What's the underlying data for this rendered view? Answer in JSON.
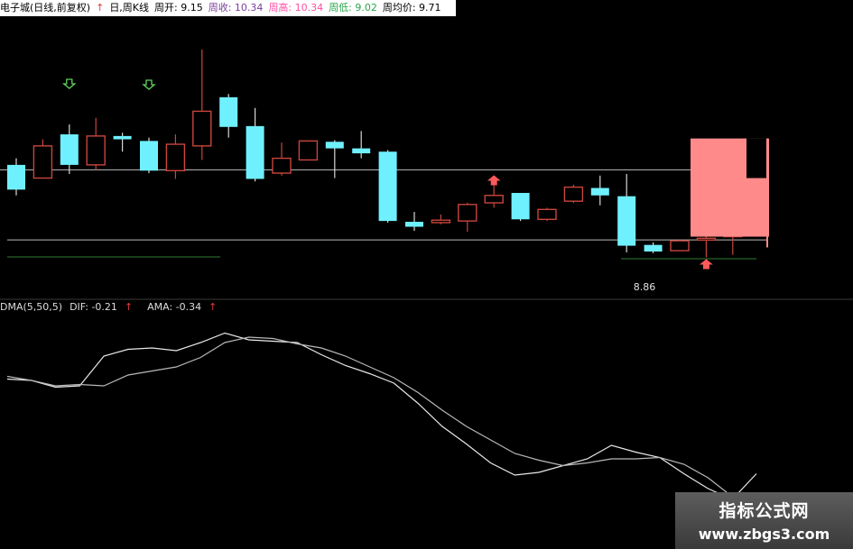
{
  "header": {
    "title": "电子城(日线,前复权)",
    "period_arrow": "↑",
    "period_label": "日,周K线",
    "open_label": "周开: 9.15",
    "close_label": "周收: 10.34",
    "high_label": "周高: 10.34",
    "low_label": "周低: 9.02",
    "avg_label": "周均价: 9.71"
  },
  "indicator": {
    "name": "DMA(5,50,5)",
    "dif_label": "DIF: -0.21",
    "ama_label": "AMA: -0.34",
    "arrow": "↑"
  },
  "price_label": "8.86",
  "watermark": {
    "title": "指标公式网",
    "url": "www.zbgs3.com"
  },
  "colors": {
    "up": "#c8453c",
    "down": "#6ff0ff",
    "weekly": "#ff8a8a",
    "line": "#d0d0d0",
    "low_line": "#2e7d32",
    "arrow_down": "#5fd35f",
    "arrow_up": "#ff5a5a"
  },
  "chart_data": [
    {
      "type": "candlestick",
      "title": "电子城(日线,前复权)",
      "price_scale": {
        "top": 11.8,
        "bottom": 8.5
      },
      "candles": [
        {
          "o": 10.02,
          "c": 9.72,
          "h": 10.1,
          "l": 9.65
        },
        {
          "o": 9.86,
          "c": 10.25,
          "h": 10.33,
          "l": 9.86
        },
        {
          "o": 10.39,
          "c": 10.02,
          "h": 10.51,
          "l": 9.91
        },
        {
          "o": 10.02,
          "c": 10.37,
          "h": 10.59,
          "l": 9.96
        },
        {
          "o": 10.37,
          "c": 10.33,
          "h": 10.41,
          "l": 10.18
        },
        {
          "o": 10.31,
          "c": 9.95,
          "h": 10.35,
          "l": 9.92
        },
        {
          "o": 9.95,
          "c": 10.27,
          "h": 10.39,
          "l": 9.85
        },
        {
          "o": 10.25,
          "c": 10.67,
          "h": 11.42,
          "l": 10.08
        },
        {
          "o": 10.84,
          "c": 10.48,
          "h": 10.88,
          "l": 10.35
        },
        {
          "o": 10.49,
          "c": 9.85,
          "h": 10.71,
          "l": 9.82
        },
        {
          "o": 9.92,
          "c": 10.1,
          "h": 10.29,
          "l": 9.89
        },
        {
          "o": 10.08,
          "c": 10.31,
          "h": 10.31,
          "l": 10.08
        },
        {
          "o": 10.3,
          "c": 10.22,
          "h": 10.32,
          "l": 9.86
        },
        {
          "o": 10.22,
          "c": 10.16,
          "h": 10.43,
          "l": 10.1
        },
        {
          "o": 10.18,
          "c": 9.34,
          "h": 10.2,
          "l": 9.32
        },
        {
          "o": 9.33,
          "c": 9.27,
          "h": 9.45,
          "l": 9.22
        },
        {
          "o": 9.32,
          "c": 9.35,
          "h": 9.42,
          "l": 9.3
        },
        {
          "o": 9.34,
          "c": 9.54,
          "h": 9.56,
          "l": 9.21
        },
        {
          "o": 9.56,
          "c": 9.65,
          "h": 9.78,
          "l": 9.5
        },
        {
          "o": 9.68,
          "c": 9.36,
          "h": 9.68,
          "l": 9.34
        },
        {
          "o": 9.36,
          "c": 9.48,
          "h": 9.5,
          "l": 9.34
        },
        {
          "o": 9.58,
          "c": 9.75,
          "h": 9.78,
          "l": 9.56
        },
        {
          "o": 9.74,
          "c": 9.65,
          "h": 9.89,
          "l": 9.53
        },
        {
          "o": 9.64,
          "c": 9.04,
          "h": 9.91,
          "l": 8.96
        },
        {
          "o": 9.05,
          "c": 8.97,
          "h": 9.08,
          "l": 8.95
        },
        {
          "o": 8.98,
          "c": 9.1,
          "h": 9.11,
          "l": 8.98
        },
        {
          "o": 9.11,
          "c": 9.13,
          "h": 9.24,
          "l": 8.9
        },
        {
          "o": 9.15,
          "c": 9.5,
          "h": 9.52,
          "l": 8.93
        }
      ],
      "weekly_candle": {
        "o": 9.15,
        "c": 10.34,
        "h": 10.34,
        "l": 9.02
      },
      "reference_lines": [
        9.96,
        9.11
      ],
      "low_marker": 8.86
    },
    {
      "type": "line",
      "title": "DMA(5,50,5)",
      "series": [
        {
          "name": "DIF",
          "values": [
            -0.02,
            -0.03,
            -0.08,
            -0.07,
            0.15,
            0.2,
            0.21,
            0.19,
            0.25,
            0.32,
            0.27,
            0.26,
            0.25,
            0.16,
            0.08,
            0.02,
            -0.05,
            -0.2,
            -0.37,
            -0.5,
            -0.64,
            -0.73,
            -0.71,
            -0.66,
            -0.61,
            -0.51,
            -0.56,
            -0.6,
            -0.72,
            -0.83,
            -0.91,
            -0.72
          ]
        },
        {
          "name": "AMA",
          "values": [
            0.0,
            -0.03,
            -0.07,
            -0.06,
            -0.07,
            0.01,
            0.04,
            0.07,
            0.14,
            0.25,
            0.29,
            0.28,
            0.24,
            0.21,
            0.15,
            0.07,
            -0.01,
            -0.12,
            -0.25,
            -0.37,
            -0.47,
            -0.57,
            -0.62,
            -0.66,
            -0.64,
            -0.61,
            -0.61,
            -0.6,
            -0.65,
            -0.75,
            -0.89,
            -0.89
          ]
        }
      ],
      "ylim": [
        -1.05,
        0.45
      ]
    }
  ]
}
